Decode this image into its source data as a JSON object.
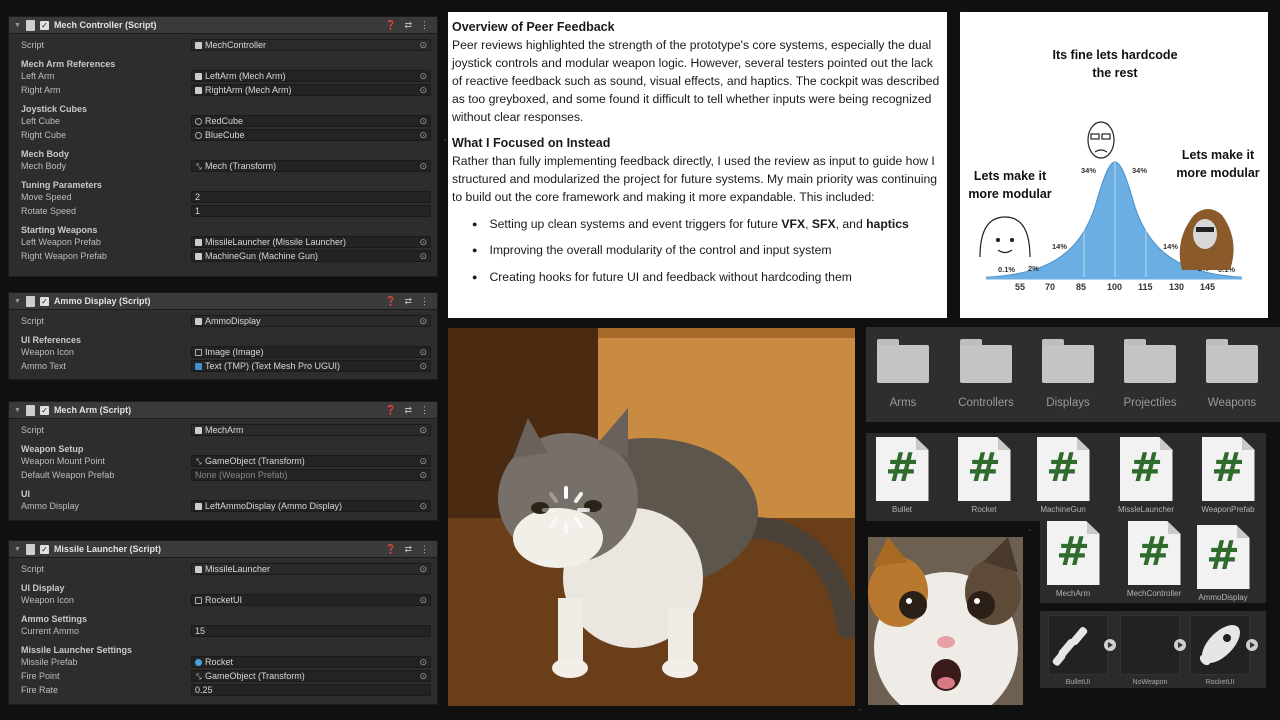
{
  "inspector": {
    "mech_controller": {
      "title": "Mech Controller (Script)",
      "script_label": "Script",
      "script_value": "MechController",
      "sec_refs": "Mech Arm References",
      "left_arm_label": "Left Arm",
      "left_arm_value": "LeftArm (Mech Arm)",
      "right_arm_label": "Right Arm",
      "right_arm_value": "RightArm (Mech Arm)",
      "sec_cubes": "Joystick Cubes",
      "left_cube_label": "Left Cube",
      "left_cube_value": "RedCube",
      "right_cube_label": "Right Cube",
      "right_cube_value": "BlueCube",
      "sec_body": "Mech Body",
      "body_label": "Mech Body",
      "body_value": "Mech (Transform)",
      "sec_tuning": "Tuning Parameters",
      "move_label": "Move Speed",
      "move_value": "2",
      "rotate_label": "Rotate Speed",
      "rotate_value": "1",
      "sec_weapons": "Starting Weapons",
      "lw_label": "Left Weapon Prefab",
      "lw_value": "MissileLauncher (Missile Launcher)",
      "rw_label": "Right Weapon Prefab",
      "rw_value": "MachineGun (Machine Gun)"
    },
    "ammo_display": {
      "title": "Ammo Display (Script)",
      "script_label": "Script",
      "script_value": "AmmoDisplay",
      "sec_ui": "UI References",
      "icon_label": "Weapon Icon",
      "icon_value": "Image (Image)",
      "text_label": "Ammo Text",
      "text_value": "Text (TMP) (Text Mesh Pro UGUI)"
    },
    "mech_arm": {
      "title": "Mech Arm (Script)",
      "script_label": "Script",
      "script_value": "MechArm",
      "sec_setup": "Weapon Setup",
      "mount_label": "Weapon Mount Point",
      "mount_value": "GameObject (Transform)",
      "default_label": "Default Weapon Prefab",
      "default_value": "None (Weapon Prefab)",
      "sec_ui": "UI",
      "ammo_label": "Ammo Display",
      "ammo_value": "LeftAmmoDisplay (Ammo Display)"
    },
    "missile_launcher": {
      "title": "Missile Launcher (Script)",
      "script_label": "Script",
      "script_value": "MissileLauncher",
      "sec_ui": "UI Display",
      "icon_label": "Weapon Icon",
      "icon_value": "RocketUI",
      "sec_ammo": "Ammo Settings",
      "ammo_label": "Current Ammo",
      "ammo_value": "15",
      "sec_launcher": "Missile Launcher Settings",
      "prefab_label": "Missile Prefab",
      "prefab_value": "Rocket",
      "fire_point_label": "Fire Point",
      "fire_point_value": "GameObject (Transform)",
      "fire_rate_label": "Fire Rate",
      "fire_rate_value": "0.25"
    }
  },
  "document": {
    "h1": "Overview of Peer Feedback",
    "p1": "Peer reviews highlighted the strength of the prototype's core systems, especially the dual joystick controls and modular weapon logic. However, several testers pointed out the lack of reactive feedback such as sound, visual effects, and haptics. The cockpit was described as too greyboxed, and some found it difficult to tell whether inputs were being recognized without clear responses.",
    "h2": "What I Focused on Instead",
    "p2": "Rather than fully implementing feedback directly, I used the review as input to guide how I structured and modularized the project for future systems. My main priority was continuing to build out the core framework and making it more expandable. This included:",
    "b1_pre": "Setting up clean systems and event triggers for future ",
    "b1_vfx": "VFX",
    "b1_sep1": ", ",
    "b1_sfx": "SFX",
    "b1_sep2": ", and ",
    "b1_hap": "haptics",
    "b2": "Improving the overall modularity of the control and input system",
    "b3": "Creating hooks for future UI and feedback without hardcoding them"
  },
  "meme": {
    "top": "Its fine lets hardcode the rest",
    "left": "Lets make it more modular",
    "right": "Lets make it more modular",
    "pct": [
      "0.1%",
      "2%",
      "14%",
      "34%",
      "34%",
      "14%",
      "2%",
      "0.1%"
    ],
    "iq": [
      "55",
      "70",
      "85",
      "100",
      "115",
      "130",
      "145"
    ]
  },
  "project": {
    "folders": [
      "Arms",
      "Controllers",
      "Displays",
      "Projectiles",
      "Weapons"
    ],
    "scripts_row1": [
      "Bullet",
      "Rocket",
      "MachineGun",
      "MissleLauncher",
      "WeaponPrefab"
    ],
    "scripts_row2": [
      "MechArm",
      "MechController",
      "AmmoDisplay"
    ],
    "sprites": [
      "BulletUI",
      "NoWeapon",
      "RocketUI"
    ],
    "script_glyph": "#"
  }
}
